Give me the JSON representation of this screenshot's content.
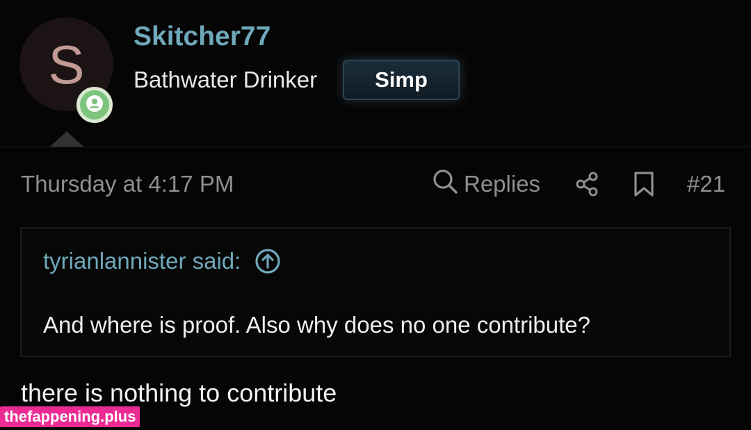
{
  "user": {
    "avatar_letter": "S",
    "username": "Skitcher77",
    "title": "Bathwater Drinker",
    "banner": "Simp",
    "status_icon": "user-online-icon",
    "status_color": "#7dc47d"
  },
  "post": {
    "date": "Thursday at 4:17 PM",
    "actions": {
      "replies_label": "Replies",
      "replies_icon": "search-icon",
      "share_icon": "share-icon",
      "bookmark_icon": "bookmark-icon",
      "post_number": "#21"
    },
    "quote": {
      "author_line": "tyrianlannister said:",
      "jump_icon": "arrow-up-circle-icon",
      "text": "And where is proof. Also why does no one contribute?"
    },
    "message": "there is nothing to contribute"
  },
  "watermark": "thefappening.plus",
  "colors": {
    "background": "#050505",
    "link": "#6fa8ba",
    "muted": "#8f8f8f",
    "watermark_bg": "#ec2a94"
  }
}
